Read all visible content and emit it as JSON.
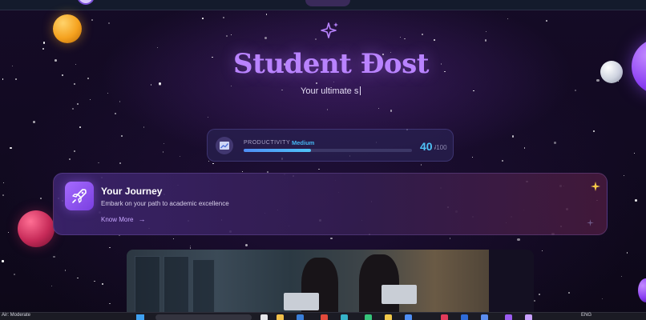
{
  "hero": {
    "title": "Student Đost",
    "subtitle": "Your ultimate s"
  },
  "productivity": {
    "label": "PRODUCTIVITY",
    "level": "Medium",
    "score": "40",
    "max": "/100",
    "progress_percent": 40
  },
  "journey": {
    "title": "Your Journey",
    "description": "Embark on your path to academic excellence",
    "link_label": "Know More"
  },
  "taskbar": {
    "weather": "Air: Moderate",
    "language": "ENG"
  },
  "colors": {
    "title": "#b983ff",
    "accent_blue": "#4fc3f7",
    "rocket_tile": "#a56bff",
    "link": "#c7a6ff",
    "background": "#120a22"
  },
  "icons": [
    "sparkle-icon",
    "chart-icon",
    "rocket-icon",
    "arrow-right-icon",
    "star-sparkle-icon"
  ]
}
